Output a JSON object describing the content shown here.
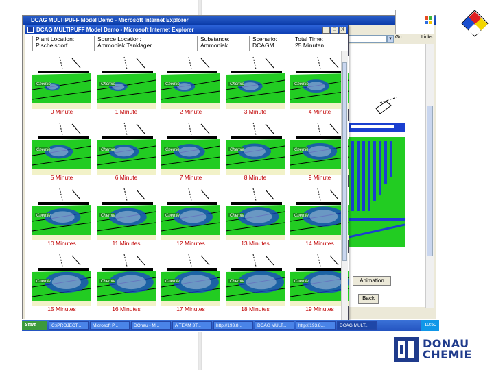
{
  "back_window": {
    "title": "DCAG MULTIPUFF Model Demo - Microsoft Internet Explorer",
    "buttons": [
      "_",
      "□",
      "X"
    ],
    "go_label": "Go",
    "links_label": "Links",
    "animation_label": "Animation",
    "back_label": "Back"
  },
  "front_window": {
    "title": "DCAG MULTIPUFF Model Demo - Microsoft Internet Explorer",
    "buttons": [
      "_",
      "□",
      "X"
    ],
    "info": [
      {
        "label": "Plant Location:",
        "value": "Pischelsdorf"
      },
      {
        "label": "Source Location:",
        "value": "Ammoniak Tanklager"
      },
      {
        "label": "Substance:",
        "value": "Ammoniak"
      },
      {
        "label": "Scenario:",
        "value": "DCAGM"
      },
      {
        "label": "Total Time:",
        "value": "25 Minuten"
      }
    ],
    "frames": [
      {
        "caption": "0 Minute",
        "spread": 0.05
      },
      {
        "caption": "1 Minute",
        "spread": 0.12
      },
      {
        "caption": "2 Minute",
        "spread": 0.2
      },
      {
        "caption": "3 Minute",
        "spread": 0.28
      },
      {
        "caption": "4 Minute",
        "spread": 0.34
      },
      {
        "caption": "5 Minute",
        "spread": 0.38
      },
      {
        "caption": "6 Minute",
        "spread": 0.42
      },
      {
        "caption": "7 Minute",
        "spread": 0.46
      },
      {
        "caption": "8 Minute",
        "spread": 0.5
      },
      {
        "caption": "9 Minute",
        "spread": 0.54
      },
      {
        "caption": "10 Minutes",
        "spread": 0.58
      },
      {
        "caption": "11 Minutes",
        "spread": 0.62
      },
      {
        "caption": "12 Minutes",
        "spread": 0.66
      },
      {
        "caption": "13 Minutes",
        "spread": 0.7
      },
      {
        "caption": "14 Minutes",
        "spread": 0.74
      },
      {
        "caption": "15 Minutes",
        "spread": 0.78
      },
      {
        "caption": "16 Minutes",
        "spread": 0.8
      },
      {
        "caption": "17 Minutes",
        "spread": 0.82
      },
      {
        "caption": "18 Minutes",
        "spread": 0.84
      },
      {
        "caption": "19 Minutes",
        "spread": 0.86
      }
    ],
    "map_label": "Chemie"
  },
  "taskbar": {
    "start": "Start",
    "tasks": [
      {
        "label": "C:\\PROJECT...",
        "active": false
      },
      {
        "label": "Microsoft P...",
        "active": false
      },
      {
        "label": "DOnau - M...",
        "active": false
      },
      {
        "label": "A TEAM 3T...",
        "active": false
      },
      {
        "label": "http://193.8...",
        "active": false
      },
      {
        "label": "DCAG MULT...",
        "active": false
      },
      {
        "label": "http://193.8...",
        "active": false
      },
      {
        "label": "DCAG MULT...",
        "active": true
      }
    ],
    "clock": "10:50"
  },
  "logo": {
    "line1": "DONAU",
    "line2": "CHEMIE",
    "color": "#1f3b8c"
  },
  "colors": {
    "terrain": "#22cc22",
    "plume": "#1a3fd0",
    "caption": "#c00000"
  }
}
